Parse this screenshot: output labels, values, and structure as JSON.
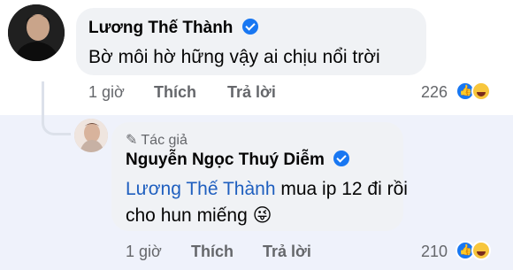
{
  "comment": {
    "author": "Lương Thế Thành",
    "text": "Bờ môi hờ hững vậy ai chịu nổi trời",
    "time": "1 giờ",
    "like": "Thích",
    "reply": "Trả lời",
    "reactions": "226"
  },
  "reply": {
    "tag": "Tác giả",
    "author": "Nguyễn Ngọc Thuý Diễm",
    "mention": "Lương Thế Thành",
    "text_line1": " mua ip 12 đi rồi",
    "text_line2": "cho hun miếng 😜",
    "time": "1 giờ",
    "like": "Thích",
    "reply": "Trả lời",
    "reactions": "210"
  },
  "colors": {
    "reply_bg": "#eff2fb",
    "bubble": "#f0f2f5",
    "mention": "#1f5fbf",
    "verified": "#1877f2"
  }
}
